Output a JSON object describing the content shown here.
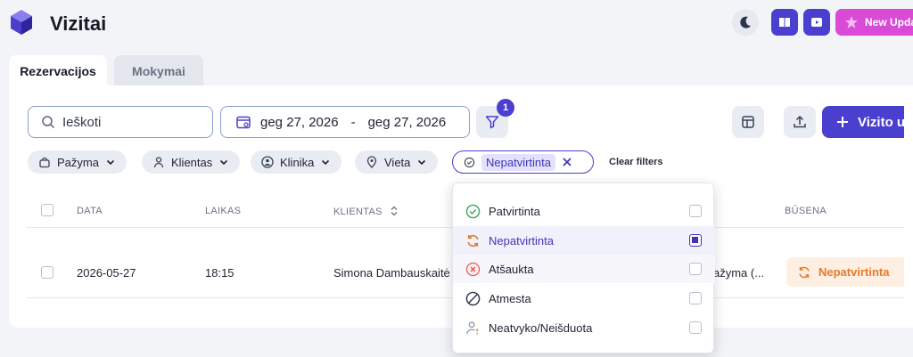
{
  "app": {
    "title": "Vizitai"
  },
  "topbar": {
    "new_updates_label": "New Updat"
  },
  "tabs": [
    {
      "label": "Rezervacijos"
    },
    {
      "label": "Mokymai"
    }
  ],
  "toolbar": {
    "search_placeholder": "Ieškoti",
    "date_from": "geg 27, 2026",
    "date_sep": "-",
    "date_to": "geg 27, 2026",
    "filter_count": "1",
    "add_label": "Vizito už"
  },
  "filters": {
    "chips": [
      {
        "label": "Pažyma"
      },
      {
        "label": "Klientas"
      },
      {
        "label": "Klinika"
      },
      {
        "label": "Vieta"
      }
    ],
    "active_value": "Nepatvirtinta",
    "clear_label": "Clear filters"
  },
  "table": {
    "headers": [
      "DATA",
      "LAIKAS",
      "KLIENTAS",
      "BŪSENA"
    ],
    "rows": [
      {
        "date": "2026-05-27",
        "time": "18:15",
        "client": "Simona Dambauskaitė",
        "service": "ažyma (...",
        "status": "Nepatvirtinta"
      }
    ]
  },
  "status_options": [
    {
      "label": "Patvirtinta",
      "checked": false
    },
    {
      "label": "Nepatvirtinta",
      "checked": true
    },
    {
      "label": "Atšaukta",
      "checked": false
    },
    {
      "label": "Atmesta",
      "checked": false
    },
    {
      "label": "Neatvyko/Neišduota",
      "checked": false
    }
  ],
  "colors": {
    "accent": "#4b3fcf",
    "orange": "#e8782b",
    "pink": "#d94ad6",
    "green": "#3ba55c",
    "red": "#e05252"
  }
}
